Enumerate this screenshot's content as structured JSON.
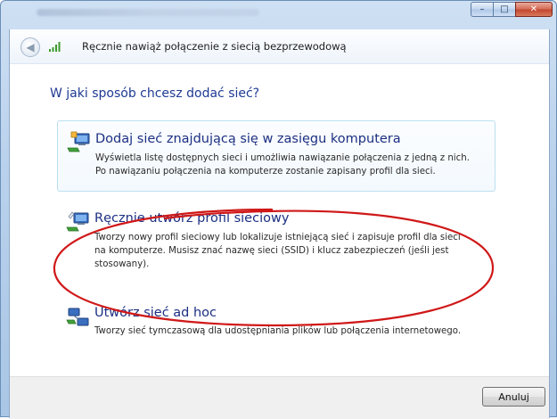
{
  "window": {
    "minimize_symbol": "–",
    "maximize_symbol": "□",
    "close_symbol": "✕"
  },
  "header": {
    "back_symbol": "◀",
    "title": "Ręcznie nawiąż połączenie z siecią bezprzewodową"
  },
  "main": {
    "question": "W jaki sposób chcesz dodać sieć?",
    "options": [
      {
        "title": "Dodaj sieć znajdującą się w zasięgu komputera",
        "desc_lines": [
          "Wyświetla listę dostępnych sieci i umożliwia nawiązanie połączenia z jedną z nich.",
          "Po nawiązaniu połączenia na komputerze zostanie zapisany profil dla sieci."
        ],
        "icon": "network-add-icon"
      },
      {
        "title": "Ręcznie utwórz profil sieciowy",
        "desc_lines": [
          "Tworzy nowy profil sieciowy lub lokalizuje istniejącą sieć i zapisuje profil dla sieci",
          "na komputerze. Musisz znać nazwę sieci (SSID) i klucz zabezpieczeń (jeśli jest",
          "stosowany)."
        ],
        "icon": "network-manual-icon"
      },
      {
        "title": "Utwórz sieć ad hoc",
        "desc_lines": [
          "Tworzy sieć tymczasową dla  udostępniania plików lub połączenia internetowego."
        ],
        "icon": "adhoc-network-icon"
      }
    ]
  },
  "footer": {
    "cancel_label": "Anuluj"
  },
  "colors": {
    "title_blue": "#1c2f82",
    "annotation_red": "#d01818"
  }
}
